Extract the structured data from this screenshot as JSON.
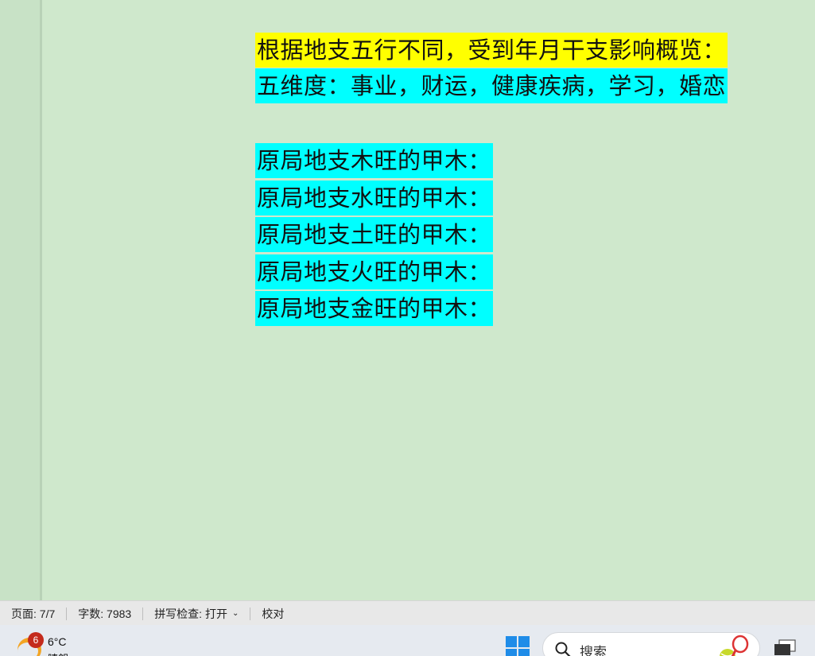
{
  "document": {
    "line_title": "根据地支五行不同，受到年月干支影响概览：",
    "line_dimensions": "五维度：事业，财运，健康疾病，学习，婚恋",
    "lines": [
      "原局地支木旺的甲木：",
      "原局地支水旺的甲木：",
      "原局地支土旺的甲木：",
      "原局地支火旺的甲木：",
      "原局地支金旺的甲木："
    ],
    "highlight_colors": {
      "yellow": "#ffff00",
      "cyan": "#00ffff"
    }
  },
  "status_bar": {
    "page": "页面: 7/7",
    "word_count": "字数: 7983",
    "spell_check": "拼写检查: 打开",
    "proofread": "校对"
  },
  "taskbar": {
    "weather_badge": "6",
    "temperature": "6°C",
    "condition": "晴朗",
    "search_placeholder": "搜索",
    "icons": [
      "weather-sun-icon",
      "windows-start-icon",
      "search-icon",
      "tennis-icon",
      "task-view-icon"
    ]
  }
}
